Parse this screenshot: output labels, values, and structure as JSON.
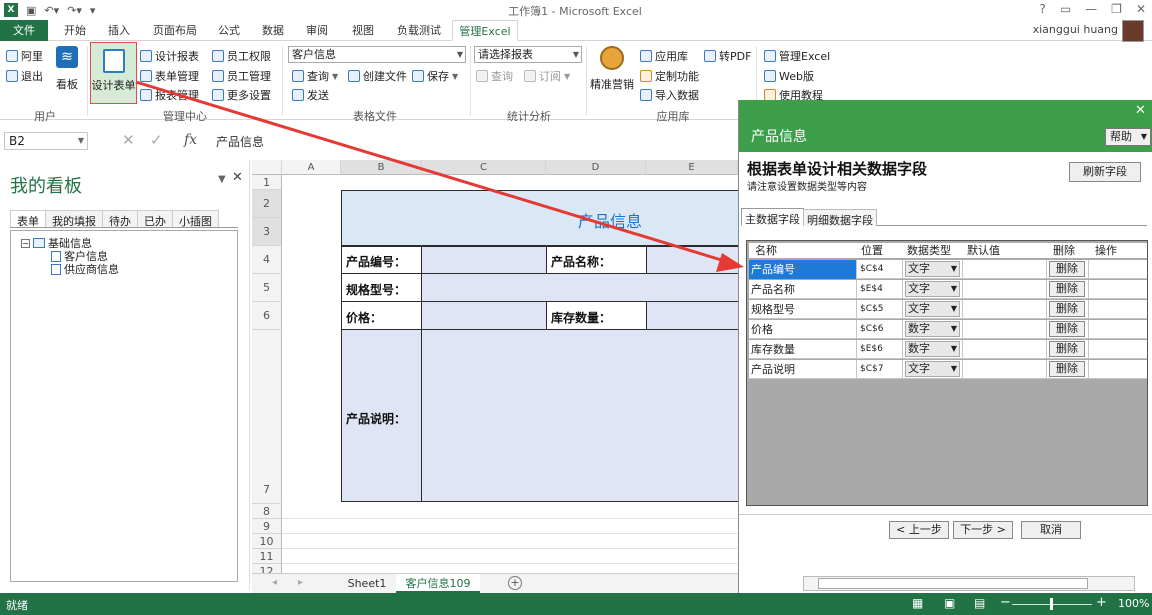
{
  "window": {
    "title": "工作簿1 - Microsoft Excel",
    "help": "?",
    "user_name": "xianggui huang"
  },
  "tabs": {
    "file": "文件",
    "items": [
      "开始",
      "插入",
      "页面布局",
      "公式",
      "数据",
      "审阅",
      "视图",
      "负载测试"
    ],
    "active": "管理Excel"
  },
  "ribbon": {
    "user_group": {
      "label": "用户",
      "ali": "阿里",
      "logout": "退出",
      "board": "看板"
    },
    "manage_group": {
      "label": "管理中心",
      "design_form": "设计表单",
      "design_report": "设计报表",
      "form_manage": "表单管理",
      "report_manage": "报表管理",
      "emp_perm": "员工权限",
      "emp_manage": "员工管理",
      "more": "更多设置"
    },
    "file_group": {
      "label": "表格文件",
      "combo": "客户信息",
      "query": "查询",
      "create": "创建文件",
      "save": "保存",
      "send": "发送"
    },
    "stats_group": {
      "label": "统计分析",
      "combo": "请选择报表",
      "query": "查询",
      "subscribe": "订阅"
    },
    "app_group": {
      "label": "应用库",
      "marketing": "精准营销",
      "app_lib": "应用库",
      "custom": "定制功能",
      "import": "导入数据",
      "pdf": "转PDF"
    },
    "extra": {
      "manage_excel": "管理Excel",
      "web": "Web版",
      "tutorial": "使用教程"
    }
  },
  "formula_bar": {
    "name_box": "B2",
    "fx": "fx",
    "content": "产品信息"
  },
  "panel": {
    "title": "我的看板",
    "tabs": [
      "表单",
      "我的填报",
      "待办",
      "已办",
      "小插图"
    ],
    "tree": {
      "root": "基础信息",
      "children": [
        "客户信息",
        "供应商信息"
      ]
    }
  },
  "sheet": {
    "columns": [
      "A",
      "B",
      "C",
      "D",
      "E"
    ],
    "rows": [
      "1",
      "2",
      "3",
      "4",
      "5",
      "6",
      "7",
      "8",
      "9",
      "10",
      "11",
      "12"
    ],
    "form_title": "产品信息",
    "labels": {
      "code": "产品编号：",
      "name": "产品名称：",
      "model": "规格型号：",
      "price": "价格：",
      "stock": "库存数量：",
      "desc": "产品说明："
    },
    "tabs": [
      "Sheet1",
      "客户信息109"
    ]
  },
  "status": {
    "ready": "就绪",
    "zoom": "100%"
  },
  "dialog": {
    "title": "产品信息",
    "help": "帮助",
    "heading": "根据表单设计相关数据字段",
    "subheading": "请注意设置数据类型等内容",
    "refresh": "刷新字段",
    "tabs": [
      "主数据字段",
      "明细数据字段"
    ],
    "headers": [
      "名称",
      "位置",
      "数据类型",
      "默认值",
      "删除",
      "操作"
    ],
    "rows": [
      {
        "name": "产品编号",
        "pos": "$C$4",
        "type": "文字",
        "del": "删除"
      },
      {
        "name": "产品名称",
        "pos": "$E$4",
        "type": "文字",
        "del": "删除"
      },
      {
        "name": "规格型号",
        "pos": "$C$5",
        "type": "文字",
        "del": "删除"
      },
      {
        "name": "价格",
        "pos": "$C$6",
        "type": "数字",
        "del": "删除"
      },
      {
        "name": "库存数量",
        "pos": "$E$6",
        "type": "数字",
        "del": "删除"
      },
      {
        "name": "产品说明",
        "pos": "$C$7",
        "type": "文字",
        "del": "删除"
      }
    ],
    "prev": "< 上一步",
    "next": "下一步 >",
    "cancel": "取消"
  },
  "colors": {
    "excel_green": "#217346",
    "dialog_green": "#3d9f4a",
    "arrow_red": "#e53935",
    "cell_fill": "#dfe5f4"
  }
}
